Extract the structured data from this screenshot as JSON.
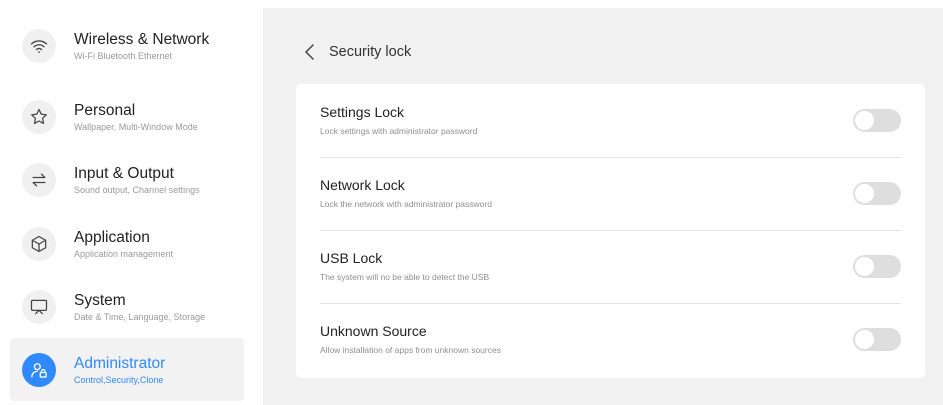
{
  "sidebar": {
    "items": [
      {
        "title": "Wireless & Network",
        "subtitle": "Wi-Fi Bluetooth Ethernet",
        "icon": "wifi-icon",
        "active": false
      },
      {
        "title": "Personal",
        "subtitle": "Wallpaper, Multi-Window Mode",
        "icon": "star-icon",
        "active": false
      },
      {
        "title": "Input & Output",
        "subtitle": "Sound output, Channel settings",
        "icon": "swap-arrows-icon",
        "active": false
      },
      {
        "title": "Application",
        "subtitle": "Application management",
        "icon": "cube-icon",
        "active": false
      },
      {
        "title": "System",
        "subtitle": "Date & Time, Language, Storage",
        "icon": "monitor-icon",
        "active": false
      },
      {
        "title": "Administrator",
        "subtitle": "Control,Security,Clone",
        "icon": "admin-lock-icon",
        "active": true
      }
    ]
  },
  "header": {
    "title": "Security lock",
    "back_icon": "chevron-left-icon"
  },
  "settings": [
    {
      "title": "Settings Lock",
      "subtitle": "Lock settings with administrator password",
      "enabled": false
    },
    {
      "title": "Network Lock",
      "subtitle": "Lock the network with administrator password",
      "enabled": false
    },
    {
      "title": "USB Lock",
      "subtitle": "The system will no be able to detect the USB",
      "enabled": false
    },
    {
      "title": "Unknown Source",
      "subtitle": "Allow installation of apps from unknown sources",
      "enabled": false
    }
  ],
  "colors": {
    "accent": "#2f89ff",
    "toggle_off": "#dedede",
    "panel_bg": "#f1f1f1"
  }
}
